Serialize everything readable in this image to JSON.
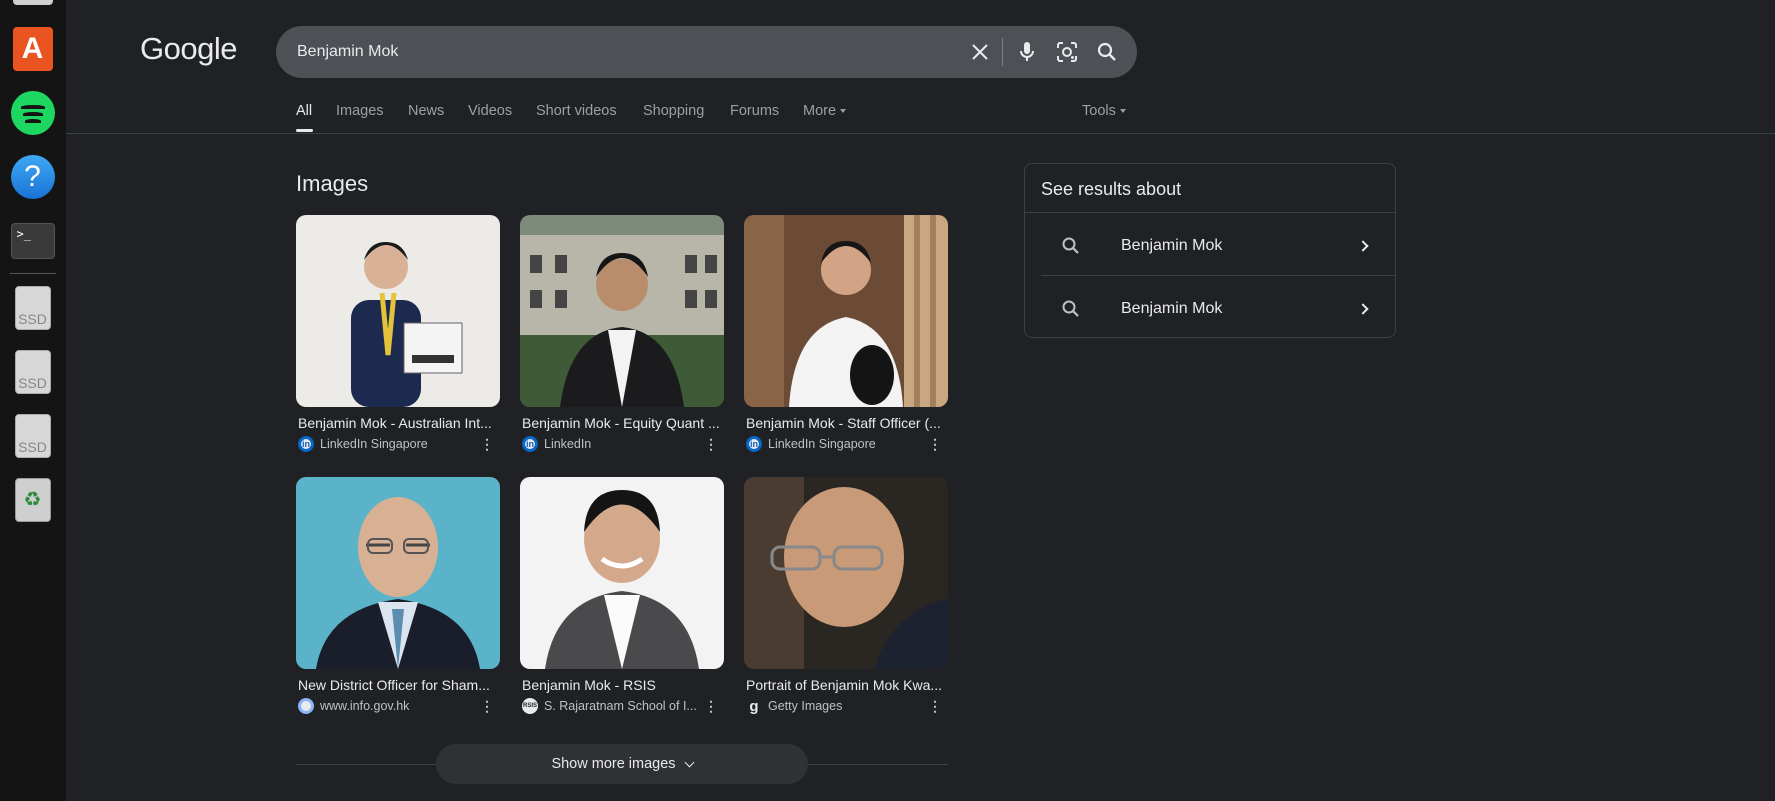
{
  "dock": {
    "items": [
      {
        "name": "app-store-icon"
      },
      {
        "name": "spotify-icon"
      },
      {
        "name": "help-icon"
      },
      {
        "name": "terminal-icon",
        "glyph": ">_"
      },
      {
        "name": "ssd-drive-icon",
        "label": "SSD"
      },
      {
        "name": "ssd-drive-icon",
        "label": "SSD"
      },
      {
        "name": "ssd-drive-icon",
        "label": "SSD"
      },
      {
        "name": "trash-icon"
      }
    ]
  },
  "header": {
    "logo": "Google",
    "search_value": "Benjamin Mok"
  },
  "tabs": [
    {
      "label": "All",
      "active": true
    },
    {
      "label": "Images"
    },
    {
      "label": "News"
    },
    {
      "label": "Videos"
    },
    {
      "label": "Short videos"
    },
    {
      "label": "Shopping"
    },
    {
      "label": "Forums"
    },
    {
      "label": "More"
    },
    {
      "label": "Tools"
    }
  ],
  "images_section": {
    "title": "Images",
    "results": [
      {
        "caption": "Benjamin Mok - Australian Int...",
        "source": "LinkedIn Singapore",
        "favicon": "linkedin"
      },
      {
        "caption": "Benjamin Mok - Equity Quant ...",
        "source": "LinkedIn",
        "favicon": "linkedin"
      },
      {
        "caption": "Benjamin Mok - Staff Officer (...",
        "source": "LinkedIn Singapore",
        "favicon": "linkedin"
      },
      {
        "caption": "New District Officer for Sham...",
        "source": "www.info.gov.hk",
        "favicon": "gov"
      },
      {
        "caption": "Benjamin Mok - RSIS",
        "source": "S. Rajaratnam School of I...",
        "favicon": "rsis"
      },
      {
        "caption": "Portrait of Benjamin Mok Kwa...",
        "source": "Getty Images",
        "favicon": "getty"
      }
    ],
    "show_more": "Show more images"
  },
  "panel": {
    "title": "See results about",
    "rows": [
      {
        "label": "Benjamin Mok"
      },
      {
        "label": "Benjamin Mok"
      }
    ]
  },
  "colors": {
    "background": "#202124",
    "search_bar": "#4d5156",
    "text": "#e8eaed",
    "muted": "#9aa0a6"
  }
}
